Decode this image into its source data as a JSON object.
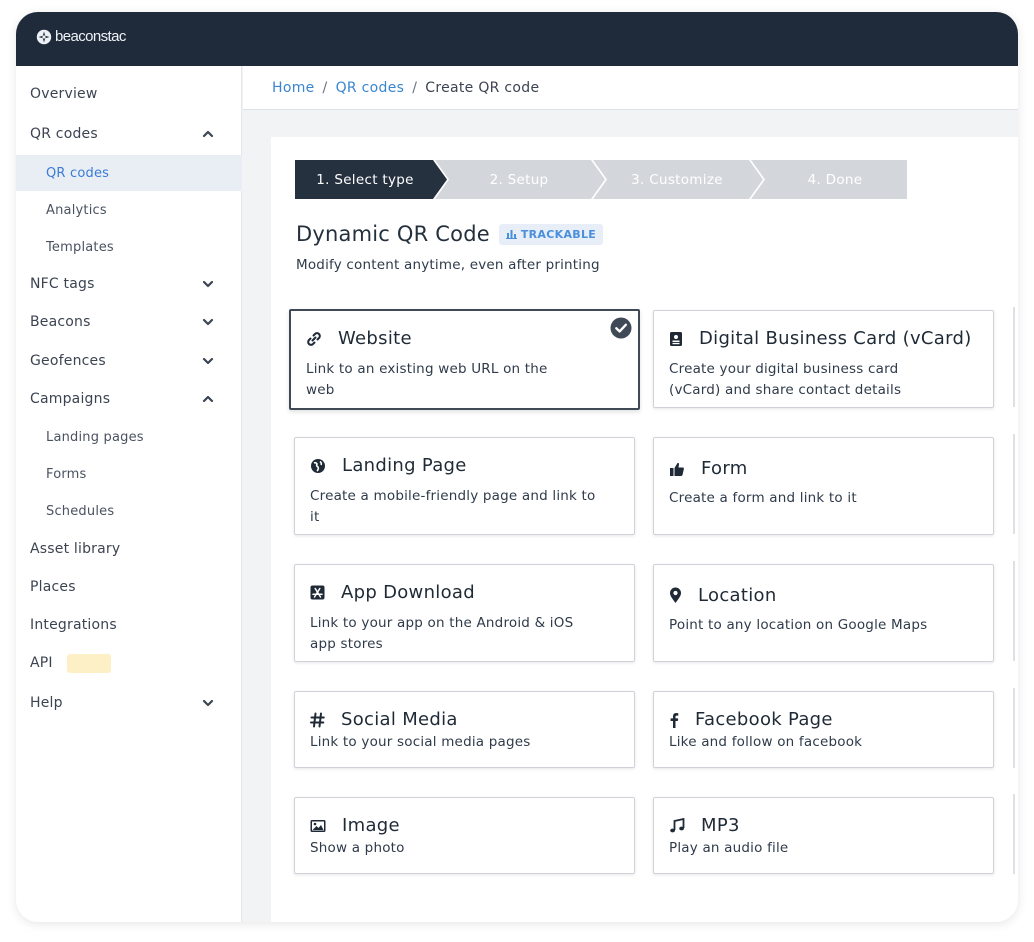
{
  "app": {
    "brand": "beaconstac"
  },
  "sidebar": {
    "items": [
      {
        "label": "Overview",
        "level": "top",
        "chevron": "none"
      },
      {
        "label": "QR codes",
        "level": "top",
        "chevron": "up"
      },
      {
        "label": "QR codes",
        "level": "sub",
        "active": true
      },
      {
        "label": "Analytics",
        "level": "sub"
      },
      {
        "label": "Templates",
        "level": "sub"
      },
      {
        "label": "NFC tags",
        "level": "top",
        "chevron": "down"
      },
      {
        "label": "Beacons",
        "level": "top",
        "chevron": "down"
      },
      {
        "label": "Geofences",
        "level": "top",
        "chevron": "down"
      },
      {
        "label": "Campaigns",
        "level": "top",
        "chevron": "up"
      },
      {
        "label": "Landing pages",
        "level": "sub"
      },
      {
        "label": "Forms",
        "level": "sub"
      },
      {
        "label": "Schedules",
        "level": "sub"
      },
      {
        "label": "Asset library",
        "level": "top",
        "chevron": "none"
      },
      {
        "label": "Places",
        "level": "top",
        "chevron": "none"
      },
      {
        "label": "Integrations",
        "level": "top",
        "chevron": "none"
      },
      {
        "label": "API",
        "level": "top",
        "chevron": "none",
        "badge": true
      },
      {
        "label": "Help",
        "level": "top",
        "chevron": "down"
      }
    ]
  },
  "breadcrumb": {
    "home": "Home",
    "sep1": "/",
    "qr_codes": "QR codes",
    "sep2": "/",
    "current": "Create QR code"
  },
  "steps": [
    {
      "label": "1. Select type",
      "active": true
    },
    {
      "label": "2. Setup",
      "active": false
    },
    {
      "label": "3. Customize",
      "active": false
    },
    {
      "label": "4. Done",
      "active": false
    }
  ],
  "heading": {
    "title": "Dynamic QR Code",
    "badge": "TRACKABLE",
    "subtitle": "Modify content anytime, even after printing"
  },
  "types": [
    {
      "title": "Website",
      "desc": "Link to an existing web URL on the web",
      "icon": "link-icon",
      "selected": true
    },
    {
      "title": "Digital Business Card (vCard)",
      "desc": "Create your digital business card (vCard) and share contact details",
      "icon": "id-card-icon"
    },
    {
      "title": "Landing Page",
      "desc": "Create a mobile-friendly page and link to it",
      "icon": "globe-icon"
    },
    {
      "title": "Form",
      "desc": "Create a form and link to it",
      "icon": "thumbs-up-icon"
    },
    {
      "title": "App Download",
      "desc": "Link to your app on the Android & iOS app stores",
      "icon": "app-store-icon"
    },
    {
      "title": "Location",
      "desc": "Point to any location on Google Maps",
      "icon": "map-pin-icon"
    },
    {
      "title": "Social Media",
      "desc": "Link to your social media pages",
      "icon": "hash-icon"
    },
    {
      "title": "Facebook Page",
      "desc": "Like and follow on facebook",
      "icon": "facebook-icon"
    },
    {
      "title": "Image",
      "desc": "Show a photo",
      "icon": "image-icon"
    },
    {
      "title": "MP3",
      "desc": "Play an audio file",
      "icon": "music-icon"
    }
  ],
  "colors": {
    "topbar": "#1f2a3a",
    "accent_link": "#3a85d0",
    "step_active": "#26313f",
    "step_inactive": "#d3d7dc",
    "badge_bg": "#e7eef8",
    "badge_text": "#4a8fdc"
  }
}
